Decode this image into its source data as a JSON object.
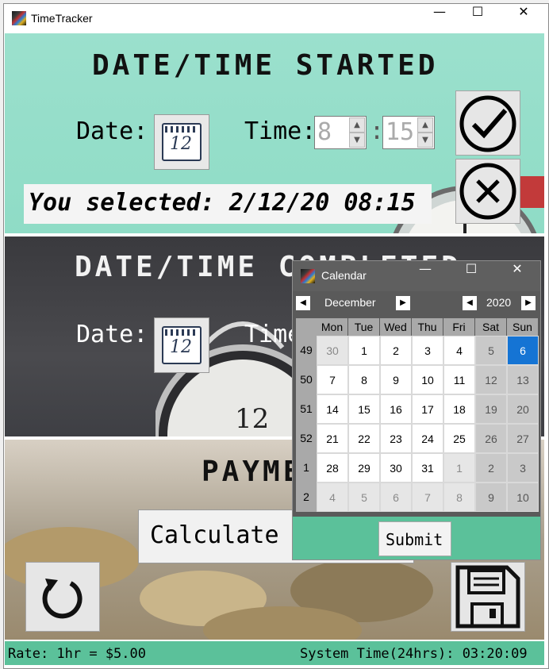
{
  "window": {
    "title": "TimeTracker"
  },
  "started": {
    "heading": "DATE/TIME STARTED",
    "date_label": "Date:",
    "calendar_icon_number": "12",
    "time_label": "Time:",
    "hour": "8",
    "colon": ":",
    "minute": "15",
    "selected_text": "You selected: 2/12/20 08:15"
  },
  "completed": {
    "heading": "DATE/TIME COMPLETED",
    "date_label": "Date:",
    "calendar_icon_number": "12",
    "time_label": "Time:",
    "clock_face_digits": "12"
  },
  "payment": {
    "heading": "PAYMENT",
    "calculate_label": "Calculate"
  },
  "status": {
    "rate": "Rate: 1hr = $5.00",
    "system_time": "System Time(24hrs): 03:20:09"
  },
  "calendar": {
    "title": "Calendar",
    "month": "December",
    "year": "2020",
    "weekdays": [
      "Mon",
      "Tue",
      "Wed",
      "Thu",
      "Fri",
      "Sat",
      "Sun"
    ],
    "weeks": [
      {
        "wk": "49",
        "days": [
          "30",
          "1",
          "2",
          "3",
          "4",
          "5",
          "6"
        ]
      },
      {
        "wk": "50",
        "days": [
          "7",
          "8",
          "9",
          "10",
          "11",
          "12",
          "13"
        ]
      },
      {
        "wk": "51",
        "days": [
          "14",
          "15",
          "16",
          "17",
          "18",
          "19",
          "20"
        ]
      },
      {
        "wk": "52",
        "days": [
          "21",
          "22",
          "23",
          "24",
          "25",
          "26",
          "27"
        ]
      },
      {
        "wk": "1",
        "days": [
          "28",
          "29",
          "30",
          "31",
          "1",
          "2",
          "3"
        ]
      },
      {
        "wk": "2",
        "days": [
          "4",
          "5",
          "6",
          "7",
          "8",
          "9",
          "10"
        ]
      }
    ],
    "selected_day": "6",
    "submit_label": "Submit"
  },
  "colors": {
    "started_bg": "#9be0cd",
    "status_bg": "#5bc19a",
    "selected_day": "#1574d4"
  }
}
